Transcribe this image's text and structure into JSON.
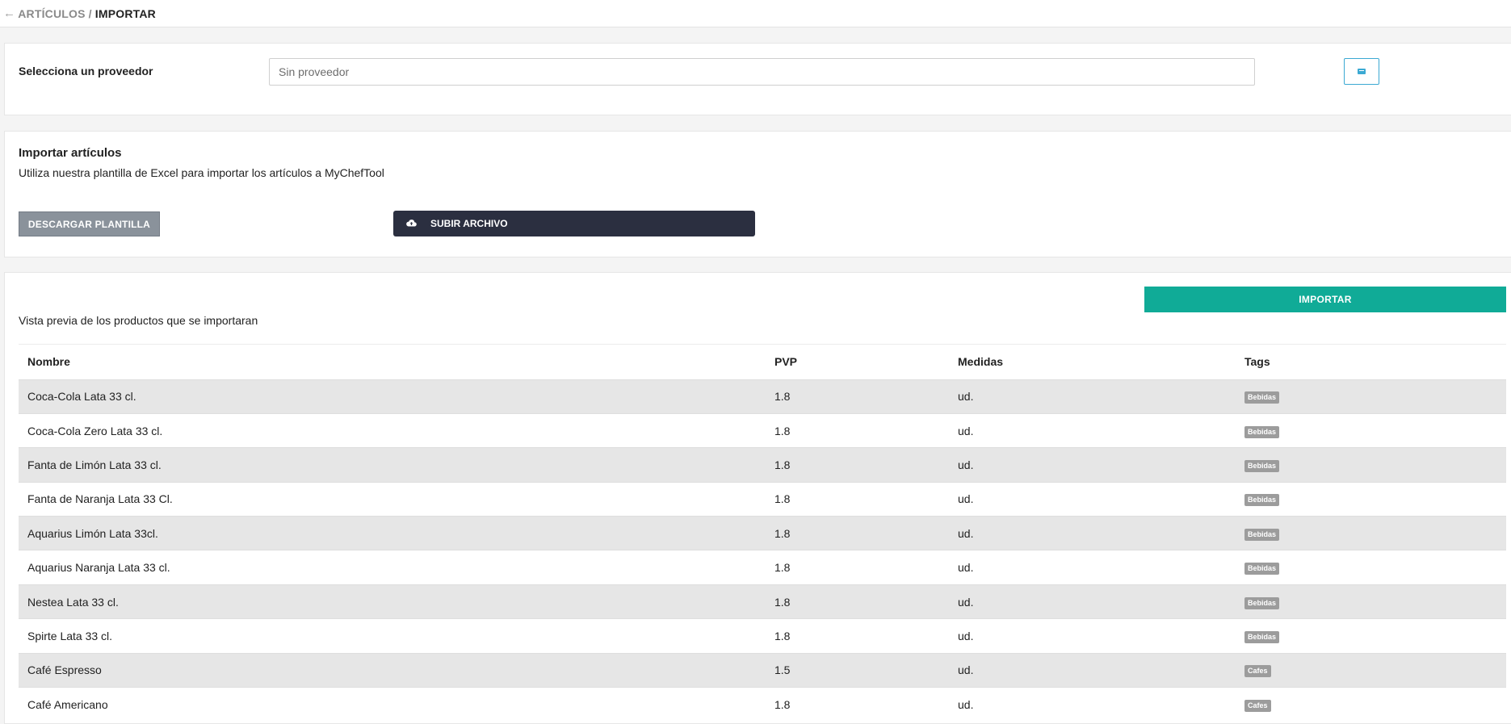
{
  "breadcrumb": {
    "back_icon": "arrow-left-icon",
    "parent": "ARTÍCULOS",
    "separator": "/",
    "current": "IMPORTAR"
  },
  "provider": {
    "label": "Selecciona un proveedor",
    "select_value": "Sin proveedor",
    "action_icon": "keyboard-icon"
  },
  "import_section": {
    "title": "Importar artículos",
    "description": "Utiliza nuestra plantilla de Excel para importar los artículos a MyChefTool",
    "download_label": "DESCARGAR PLANTILLA",
    "upload_label": "SUBIR ARCHIVO",
    "upload_icon": "cloud-upload-icon"
  },
  "preview": {
    "import_label": "IMPORTAR",
    "subtitle": "Vista previa de los productos que se importaran",
    "columns": [
      "Nombre",
      "PVP",
      "Medidas",
      "Tags"
    ],
    "rows": [
      {
        "name": "Coca-Cola Lata 33 cl.",
        "pvp": "1.8",
        "unit": "ud.",
        "tag": "Bebidas"
      },
      {
        "name": "Coca-Cola Zero Lata 33 cl.",
        "pvp": "1.8",
        "unit": "ud.",
        "tag": "Bebidas"
      },
      {
        "name": "Fanta de Limón Lata 33 cl.",
        "pvp": "1.8",
        "unit": "ud.",
        "tag": "Bebidas"
      },
      {
        "name": "Fanta de Naranja Lata 33 Cl.",
        "pvp": "1.8",
        "unit": "ud.",
        "tag": "Bebidas"
      },
      {
        "name": "Aquarius Limón Lata 33cl.",
        "pvp": "1.8",
        "unit": "ud.",
        "tag": "Bebidas"
      },
      {
        "name": "Aquarius Naranja Lata 33 cl.",
        "pvp": "1.8",
        "unit": "ud.",
        "tag": "Bebidas"
      },
      {
        "name": "Nestea Lata 33 cl.",
        "pvp": "1.8",
        "unit": "ud.",
        "tag": "Bebidas"
      },
      {
        "name": "Spirte Lata 33 cl.",
        "pvp": "1.8",
        "unit": "ud.",
        "tag": "Bebidas"
      },
      {
        "name": "Café Espresso",
        "pvp": "1.5",
        "unit": "ud.",
        "tag": "Cafes"
      },
      {
        "name": "Café Americano",
        "pvp": "1.8",
        "unit": "ud.",
        "tag": "Cafes"
      }
    ]
  },
  "colors": {
    "import_button": "#10ab97",
    "upload_button": "#2b2f40",
    "download_button": "#8a929b",
    "icon_button_border": "#3ba9d3",
    "tag_badge": "#9c9c9c"
  }
}
